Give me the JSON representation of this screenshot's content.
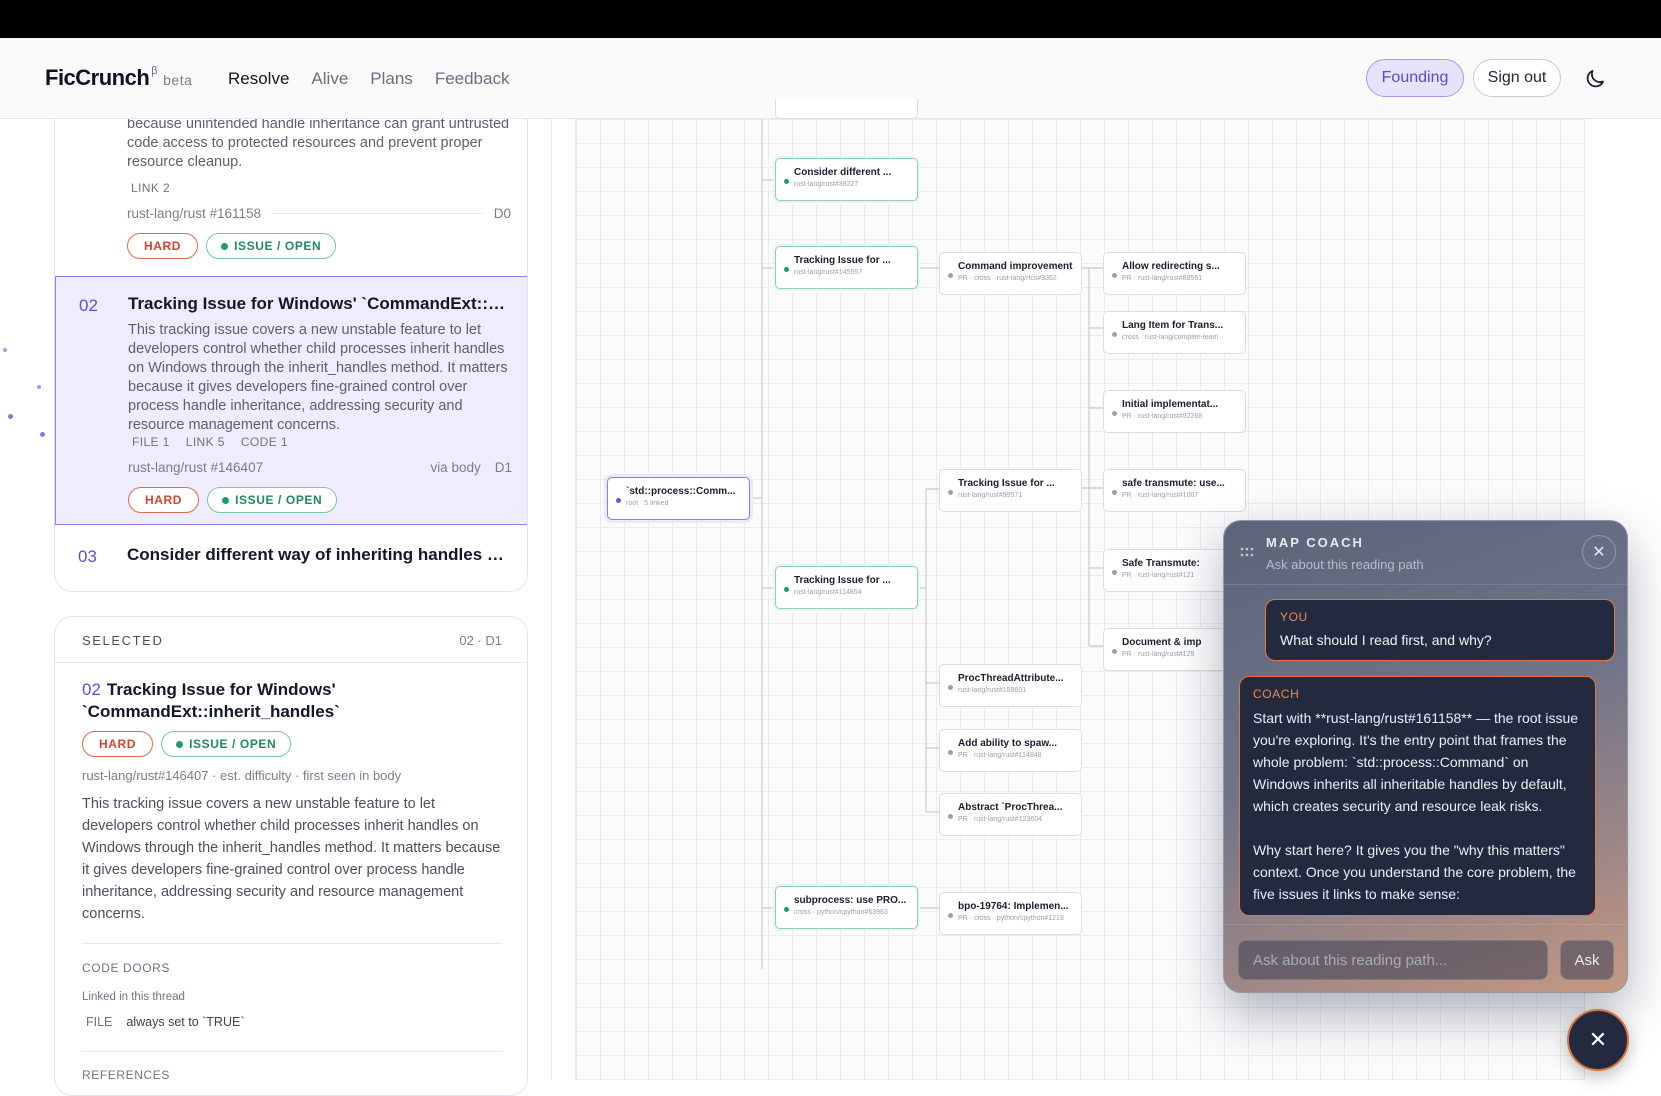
{
  "header": {
    "brand": "FicCrunch",
    "brand_sup": "β",
    "brand_tag": "beta",
    "nav": [
      "Resolve",
      "Alive",
      "Plans",
      "Feedback"
    ],
    "founding": "Founding",
    "signout": "Sign out",
    "theme_icon": "moon-icon"
  },
  "list": {
    "item1": {
      "desc": "because unintended handle inheritance can grant untrusted code access to protected resources and prevent proper resource cleanup.",
      "tags": [
        "LINK 2"
      ],
      "repo": "rust-lang/rust #161158",
      "depth": "D0",
      "hard": "HARD",
      "status": "ISSUE / OPEN"
    },
    "item2": {
      "num": "02",
      "title": "Tracking Issue for Windows' `CommandExt::inherit_handles`",
      "desc": "This tracking issue covers a new unstable feature to let developers control whether child processes inherit handles on Windows through the inherit_handles method. It matters because it gives developers fine-grained control over process handle inheritance, addressing security and resource management concerns.",
      "tags": [
        "FILE 1",
        "LINK 5",
        "CODE 1"
      ],
      "repo": "rust-lang/rust #146407",
      "via": "via body",
      "depth": "D1",
      "hard": "HARD",
      "status": "ISSUE / OPEN"
    },
    "item3": {
      "num": "03",
      "title": "Consider different way of inheriting handles in child processes"
    }
  },
  "selected": {
    "label": "SELECTED",
    "ref": "02 · D1",
    "num": "02",
    "title": "Tracking Issue for Windows' `CommandExt::inherit_handles`",
    "hard": "HARD",
    "status": "ISSUE / OPEN",
    "meta": "rust-lang/rust#146407 · est. difficulty · first seen in body",
    "desc": "This tracking issue covers a new unstable feature to let developers control whether child processes inherit handles on Windows through the inherit_handles method. It matters because it gives developers fine-grained control over process handle inheritance, addressing security and resource management concerns.",
    "code_doors": "CODE DOORS",
    "linked": "Linked in this thread",
    "file_label": "FILE",
    "file_value": "always set to `TRUE`",
    "references": "REFERENCES"
  },
  "graph": {
    "nodes": [
      {
        "title": "Consider different ...",
        "sub": "rust-lang/rust#38227",
        "kind": "green"
      },
      {
        "title": "Tracking Issue for ...",
        "sub": "rust-lang/rust#145957",
        "kind": "green"
      },
      {
        "title": "Command improvement",
        "sub": "PR · cross · rust-lang/rfcs#3362",
        "kind": "plain"
      },
      {
        "title": "Allow redirecting s...",
        "sub": "PR · rust-lang/rust#88561",
        "kind": "plain"
      },
      {
        "title": "Lang Item for Trans...",
        "sub": "cross · rust-lang/compiler-team.",
        "kind": "plain"
      },
      {
        "title": "Initial implementat...",
        "sub": "PR · rust-lang/rust#92268",
        "kind": "plain"
      },
      {
        "title": "`std::process::Comm...",
        "sub": "root · 5 linked",
        "kind": "root"
      },
      {
        "title": "Tracking Issue for ...",
        "sub": "rust-lang/rust#99571",
        "kind": "plain"
      },
      {
        "title": "safe transmute: use...",
        "sub": "PR · rust-lang/rust#1007",
        "kind": "plain"
      },
      {
        "title": "Safe Transmute:",
        "sub": "PR · rust-lang/rust#121",
        "kind": "plain"
      },
      {
        "title": "Tracking Issue for ...",
        "sub": "rust-lang/rust#114854",
        "kind": "green"
      },
      {
        "title": "Document & imp",
        "sub": "PR · rust-lang/rust#129",
        "kind": "plain"
      },
      {
        "title": "ProcThreadAttribute...",
        "sub": "rust-lang/rust#158601",
        "kind": "plain"
      },
      {
        "title": "Add ability to spaw...",
        "sub": "PR · rust-lang/rust#114848",
        "kind": "plain"
      },
      {
        "title": "Abstract `ProcThrea...",
        "sub": "PR · rust-lang/rust#123604",
        "kind": "plain"
      },
      {
        "title": "subprocess: use PRO...",
        "sub": "cross · python/cpython#63963",
        "kind": "green"
      },
      {
        "title": "bpo-19764: Implemen...",
        "sub": "PR · cross · python/cpython#1218",
        "kind": "plain"
      }
    ]
  },
  "coach": {
    "title": "MAP COACH",
    "subtitle": "Ask about this reading path",
    "you_label": "YOU",
    "you_text": "What should I read first, and why?",
    "coach_label": "COACH",
    "coach_p1": "Start with **rust-lang/rust#161158** — the root issue you're exploring. It's the entry point that frames the whole problem: `std::process::Command` on Windows inherits all inheritable handles by default, which creates security and resource leak risks.",
    "coach_p2": "Why start here? It gives you the \"why this matters\" context. Once you understand the core problem, the five issues it links to make sense:",
    "input_placeholder": "Ask about this reading path...",
    "ask": "Ask"
  }
}
